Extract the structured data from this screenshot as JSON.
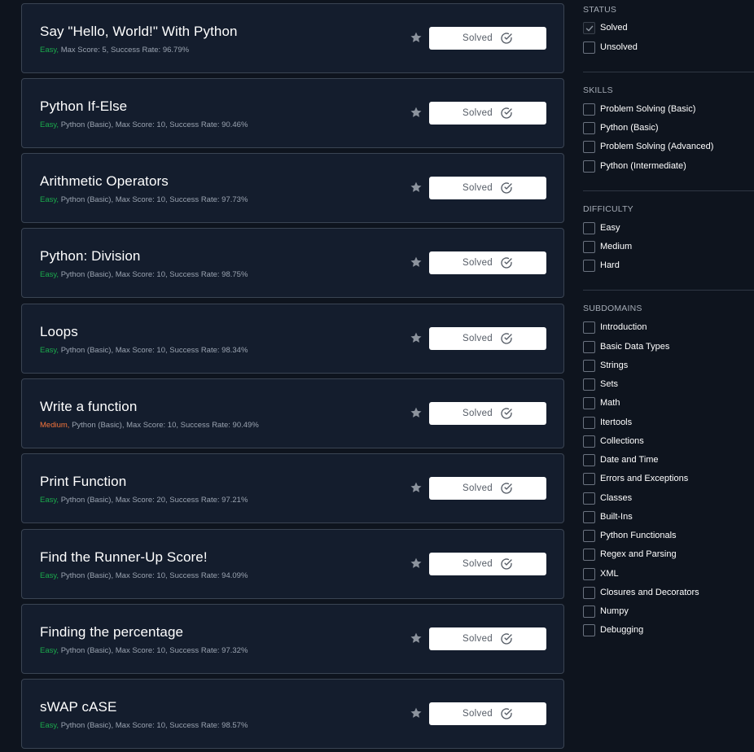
{
  "challenges": [
    {
      "title": "Say \"Hello, World!\" With Python",
      "difficulty": "Easy,",
      "difficulty_level": "easy",
      "meta": " Max Score: 5, Success Rate: 96.79%",
      "status_label": "Solved"
    },
    {
      "title": "Python If-Else",
      "difficulty": "Easy,",
      "difficulty_level": "easy",
      "meta": " Python (Basic), Max Score: 10, Success Rate: 90.46%",
      "status_label": "Solved"
    },
    {
      "title": "Arithmetic Operators",
      "difficulty": "Easy,",
      "difficulty_level": "easy",
      "meta": " Python (Basic), Max Score: 10, Success Rate: 97.73%",
      "status_label": "Solved"
    },
    {
      "title": "Python: Division",
      "difficulty": "Easy,",
      "difficulty_level": "easy",
      "meta": " Python (Basic), Max Score: 10, Success Rate: 98.75%",
      "status_label": "Solved"
    },
    {
      "title": "Loops",
      "difficulty": "Easy,",
      "difficulty_level": "easy",
      "meta": " Python (Basic), Max Score: 10, Success Rate: 98.34%",
      "status_label": "Solved"
    },
    {
      "title": "Write a function",
      "difficulty": "Medium,",
      "difficulty_level": "medium",
      "meta": " Python (Basic), Max Score: 10, Success Rate: 90.49%",
      "status_label": "Solved"
    },
    {
      "title": "Print Function",
      "difficulty": "Easy,",
      "difficulty_level": "easy",
      "meta": " Python (Basic), Max Score: 20, Success Rate: 97.21%",
      "status_label": "Solved"
    },
    {
      "title": "Find the Runner-Up Score!",
      "difficulty": "Easy,",
      "difficulty_level": "easy",
      "meta": " Python (Basic), Max Score: 10, Success Rate: 94.09%",
      "status_label": "Solved"
    },
    {
      "title": "Finding the percentage",
      "difficulty": "Easy,",
      "difficulty_level": "easy",
      "meta": " Python (Basic), Max Score: 10, Success Rate: 97.32%",
      "status_label": "Solved"
    },
    {
      "title": "sWAP cASE",
      "difficulty": "Easy,",
      "difficulty_level": "easy",
      "meta": " Python (Basic), Max Score: 10, Success Rate: 98.57%",
      "status_label": "Solved"
    }
  ],
  "filters": {
    "status": {
      "heading": "STATUS",
      "options": [
        {
          "label": "Solved",
          "checked": true
        },
        {
          "label": "Unsolved",
          "checked": false
        }
      ]
    },
    "skills": {
      "heading": "SKILLS",
      "options": [
        {
          "label": "Problem Solving (Basic)",
          "checked": false
        },
        {
          "label": "Python (Basic)",
          "checked": false
        },
        {
          "label": "Problem Solving (Advanced)",
          "checked": false
        },
        {
          "label": "Python (Intermediate)",
          "checked": false
        }
      ]
    },
    "difficulty": {
      "heading": "DIFFICULTY",
      "options": [
        {
          "label": "Easy",
          "checked": false
        },
        {
          "label": "Medium",
          "checked": false
        },
        {
          "label": "Hard",
          "checked": false
        }
      ]
    },
    "subdomains": {
      "heading": "SUBDOMAINS",
      "options": [
        {
          "label": "Introduction",
          "checked": false
        },
        {
          "label": "Basic Data Types",
          "checked": false
        },
        {
          "label": "Strings",
          "checked": false
        },
        {
          "label": "Sets",
          "checked": false
        },
        {
          "label": "Math",
          "checked": false
        },
        {
          "label": "Itertools",
          "checked": false
        },
        {
          "label": "Collections",
          "checked": false
        },
        {
          "label": "Date and Time",
          "checked": false
        },
        {
          "label": "Errors and Exceptions",
          "checked": false
        },
        {
          "label": "Classes",
          "checked": false
        },
        {
          "label": "Built-Ins",
          "checked": false
        },
        {
          "label": "Python Functionals",
          "checked": false
        },
        {
          "label": "Regex and Parsing",
          "checked": false
        },
        {
          "label": "XML",
          "checked": false
        },
        {
          "label": "Closures and Decorators",
          "checked": false
        },
        {
          "label": "Numpy",
          "checked": false
        },
        {
          "label": "Debugging",
          "checked": false
        }
      ]
    }
  },
  "icons": {
    "star": "star-icon",
    "check": "check-circle-icon",
    "checkbox_tick": "checkmark-icon"
  },
  "colors": {
    "background": "#0e141e",
    "card": "#141d2d",
    "easy": "#1ba94c",
    "medium": "#f4743b",
    "star": "#8c939d"
  }
}
